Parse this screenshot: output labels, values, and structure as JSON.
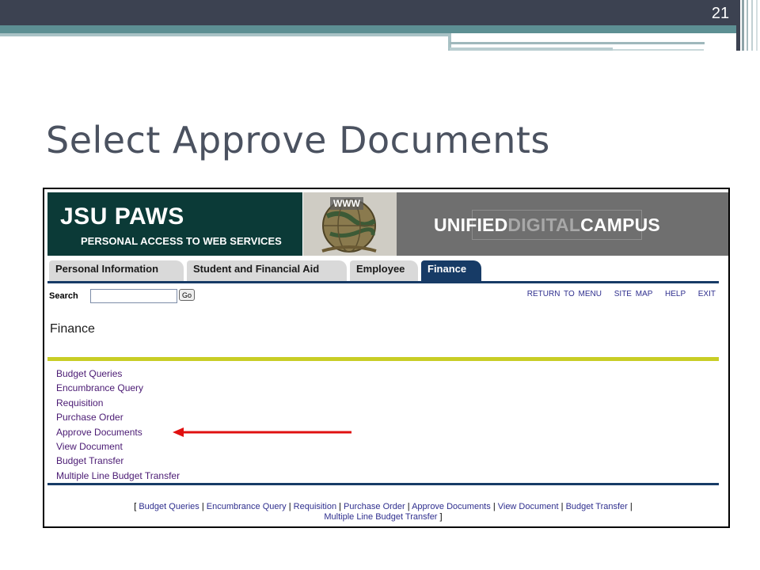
{
  "slide": {
    "number": "21",
    "title": "Select Approve Documents"
  },
  "banner": {
    "title": "JSU PAWS",
    "subtitle": "PERSONAL ACCESS TO WEB SERVICES",
    "globe_label": "WWW",
    "campus_part1": "UNIFIED",
    "campus_part2": "DIGITAL",
    "campus_part3": "CAMPUS"
  },
  "tabs": [
    {
      "label": "Personal Information",
      "active": false
    },
    {
      "label": "Student and Financial Aid",
      "active": false
    },
    {
      "label": "Employee",
      "active": false
    },
    {
      "label": "Finance",
      "active": true
    }
  ],
  "search": {
    "label": "Search",
    "value": "",
    "button_label": "Go"
  },
  "top_links": [
    "RETURN TO MENU",
    "SITE MAP",
    "HELP",
    "EXIT"
  ],
  "page_heading": "Finance",
  "menu_items": [
    "Budget Queries",
    "Encumbrance Query",
    "Requisition",
    "Purchase Order",
    "Approve Documents",
    "View Document",
    "Budget Transfer",
    "Multiple Line Budget Transfer"
  ],
  "footer_links": [
    "Budget Queries",
    "Encumbrance Query",
    "Requisition",
    "Purchase Order",
    "Approve Documents",
    "View Document",
    "Budget Transfer",
    "Multiple Line Budget Transfer"
  ],
  "colors": {
    "arrow": "#e01010",
    "tab_active": "#173b66",
    "banner_green": "#0b3a37",
    "yellow_rule": "#c8cd25",
    "link": "#4a1a73"
  }
}
